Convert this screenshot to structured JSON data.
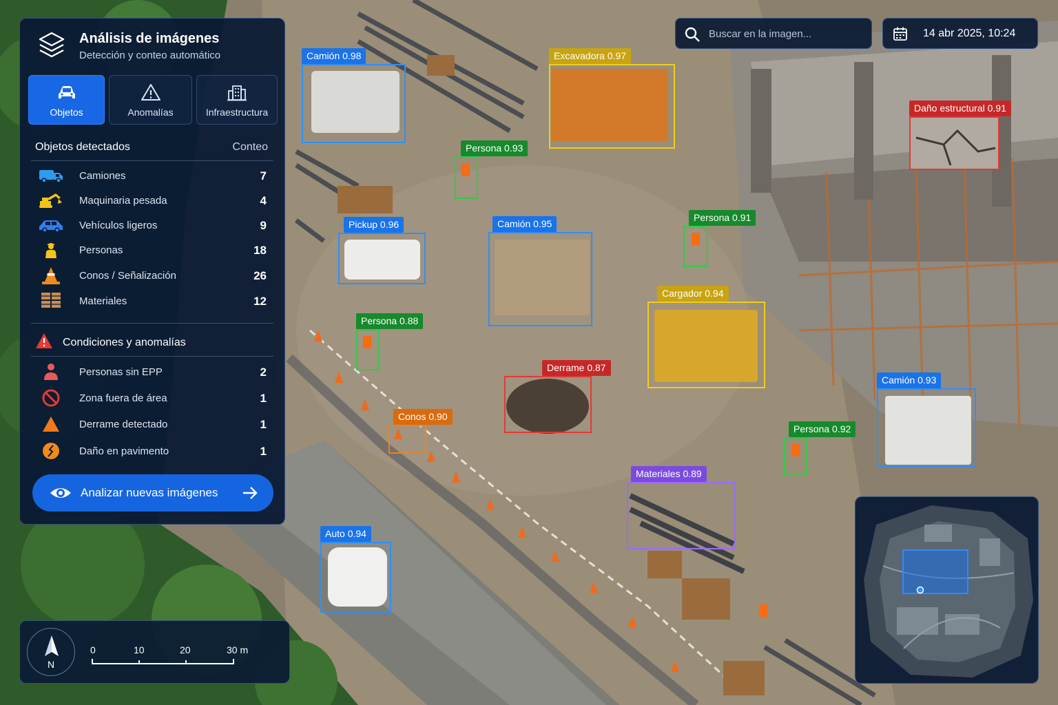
{
  "panel": {
    "title": "Análisis de imágenes",
    "subtitle": "Detección y conteo automático",
    "logo_icon": "layers-icon",
    "tabs": [
      {
        "label": "Objetos",
        "icon": "car-icon",
        "active": true
      },
      {
        "label": "Anomalías",
        "icon": "warning-icon",
        "active": false
      },
      {
        "label": "Infraestructura",
        "icon": "building-icon",
        "active": false
      }
    ],
    "objects_header": "Objetos detectados",
    "count_header": "Conteo",
    "objects": [
      {
        "label": "Camiones",
        "count": "7",
        "icon": "truck-icon",
        "color": "#2f9bf0"
      },
      {
        "label": "Maquinaria pesada",
        "count": "4",
        "icon": "excavator-icon",
        "color": "#f2c318"
      },
      {
        "label": "Vehículos ligeros",
        "count": "9",
        "icon": "car-icon",
        "color": "#2f7ff0"
      },
      {
        "label": "Personas",
        "count": "18",
        "icon": "worker-icon",
        "color": "#f5c518"
      },
      {
        "label": "Conos / Señalización",
        "count": "26",
        "icon": "cone-icon",
        "color": "#f08a1c"
      },
      {
        "label": "Materiales",
        "count": "12",
        "icon": "pallet-icon",
        "color": "#c98e52"
      }
    ],
    "conditions_header": "Condiciones y anomalías",
    "conditions_icon": "alert-triangle-icon",
    "conditions": [
      {
        "label": "Personas sin EPP",
        "count": "2",
        "icon": "person-icon",
        "color": "#e85a5a"
      },
      {
        "label": "Zona fuera de área",
        "count": "1",
        "icon": "prohibited-icon",
        "color": "#e53935"
      },
      {
        "label": "Derrame detectado",
        "count": "1",
        "icon": "triangle-icon",
        "color": "#f07a1c"
      },
      {
        "label": "Daño en pavimento",
        "count": "1",
        "icon": "crack-icon",
        "color": "#f08a1c"
      }
    ],
    "cta_label": "Analizar nuevas imágenes"
  },
  "topbar": {
    "search_placeholder": "Buscar en la imagen...",
    "date": "14 abr 2025, 10:24"
  },
  "scale": {
    "north": "N",
    "ticks": [
      "0",
      "10",
      "20",
      "30 m"
    ]
  },
  "detections": [
    {
      "label": "Camión 0.98",
      "class": "blue"
    },
    {
      "label": "Excavadora 0.97",
      "class": "yellow"
    },
    {
      "label": "Daño estructural 0.91",
      "class": "red"
    },
    {
      "label": "Persona 0.93",
      "class": "green"
    },
    {
      "label": "Pickup 0.96",
      "class": "blue"
    },
    {
      "label": "Camión 0.95",
      "class": "blue"
    },
    {
      "label": "Persona 0.91",
      "class": "green"
    },
    {
      "label": "Cargador 0.94",
      "class": "yellow"
    },
    {
      "label": "Persona 0.88",
      "class": "green"
    },
    {
      "label": "Derrame 0.87",
      "class": "red"
    },
    {
      "label": "Camión 0.93",
      "class": "blue"
    },
    {
      "label": "Conos 0.90",
      "class": "orange"
    },
    {
      "label": "Persona 0.92",
      "class": "green"
    },
    {
      "label": "Materiales 0.89",
      "class": "purple"
    },
    {
      "label": "Auto 0.94",
      "class": "blue"
    }
  ],
  "colors": {
    "panel_bg": "#0a1a34",
    "accent": "#1868e6",
    "box_blue": "#2f8ff5",
    "box_yellow": "#f3cc1d",
    "box_green": "#35c94a",
    "box_red": "#e53935",
    "box_orange": "#f0821e",
    "box_purple": "#9b6bff"
  }
}
